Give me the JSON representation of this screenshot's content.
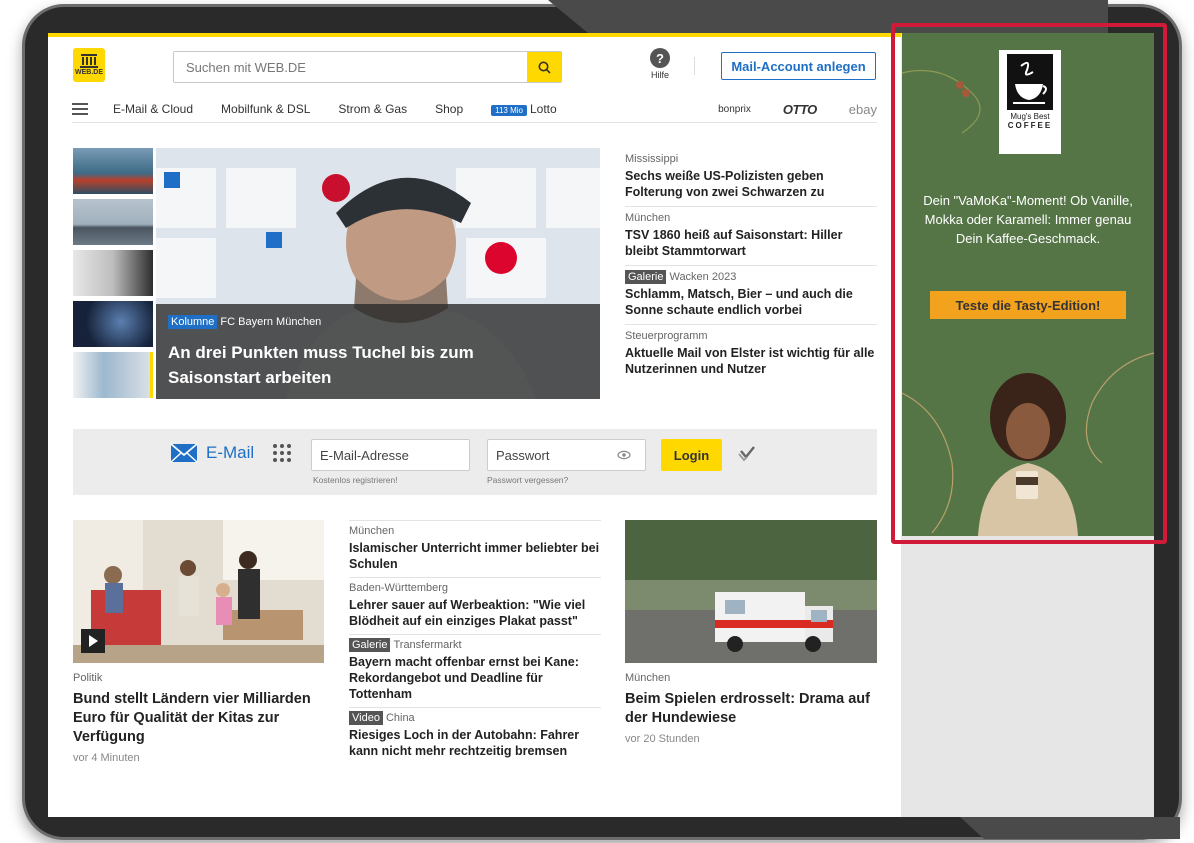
{
  "header": {
    "logo_text": "WEB.DE",
    "search_placeholder": "Suchen mit WEB.DE",
    "help_label": "Hilfe",
    "account_button": "Mail-Account anlegen"
  },
  "nav": {
    "items": [
      "E-Mail & Cloud",
      "Mobilfunk & DSL",
      "Strom & Gas",
      "Shop"
    ],
    "lotto_badge": "113 Mio",
    "lotto_label": "Lotto",
    "brands": [
      "bonprix",
      "OTTO",
      "ebay"
    ]
  },
  "hero": {
    "tag": "Kolumne",
    "topic": "FC Bayern München",
    "title": "An drei Punkten muss Tuchel bis zum Saisonstart arbeiten"
  },
  "news": [
    {
      "kicker": "Mississippi",
      "headline": "Sechs weiße US-Polizisten geben Folterung von zwei Schwarzen zu"
    },
    {
      "kicker": "München",
      "headline": "TSV 1860 heiß auf Saisonstart: Hiller bleibt Stammtorwart"
    },
    {
      "tag": "Galerie",
      "kicker": "Wacken 2023",
      "headline": "Schlamm, Matsch, Bier – und auch die Sonne schaute endlich vorbei"
    },
    {
      "kicker": "Steuerprogramm",
      "headline": "Aktuelle Mail von Elster ist wichtig für alle Nutzerinnen und Nutzer"
    }
  ],
  "mail": {
    "label": "E-Mail",
    "email_placeholder": "E-Mail-Adresse",
    "password_placeholder": "Passwort",
    "register_link": "Kostenlos registrieren!",
    "forgot_link": "Passwort vergessen?",
    "login_button": "Login"
  },
  "bottom_left": {
    "kicker": "Politik",
    "headline": "Bund stellt Ländern vier Milliarden Euro für Qualität der Kitas zur Verfügung",
    "time": "vor 4 Minuten"
  },
  "bottom_middle": [
    {
      "kicker": "München",
      "headline": "Islamischer Unterricht immer beliebter bei Schulen"
    },
    {
      "kicker": "Baden-Württemberg",
      "headline": "Lehrer sauer auf Werbeaktion: \"Wie viel Blödheit auf ein einziges Plakat passt\""
    },
    {
      "tag": "Galerie",
      "kicker": "Transfermarkt",
      "headline": "Bayern macht offenbar ernst bei Kane: Rekordangebot und Deadline für Tottenham"
    },
    {
      "tag": "Video",
      "kicker": "China",
      "headline": "Riesiges Loch in der Autobahn: Fahrer kann nicht mehr rechtzeitig bremsen"
    }
  ],
  "bottom_right": {
    "kicker": "München",
    "headline": "Beim Spielen erdrosselt: Drama auf der Hundewiese",
    "time": "vor 20 Stunden"
  },
  "ad": {
    "brand_line1": "Mug's Best",
    "brand_line2": "COFFEE",
    "text": "Dein \"VaMoKa\"-Moment! Ob Vanille, Mokka oder Karamell: Immer genau Dein Kaffee-Geschmack.",
    "cta": "Teste die Tasty-Edition!"
  },
  "colors": {
    "brand_yellow": "#ffd800",
    "link_blue": "#1e6fc5",
    "ad_green": "#557547",
    "ad_cta_orange": "#f2a21c",
    "highlight_red": "#d11a3a"
  }
}
